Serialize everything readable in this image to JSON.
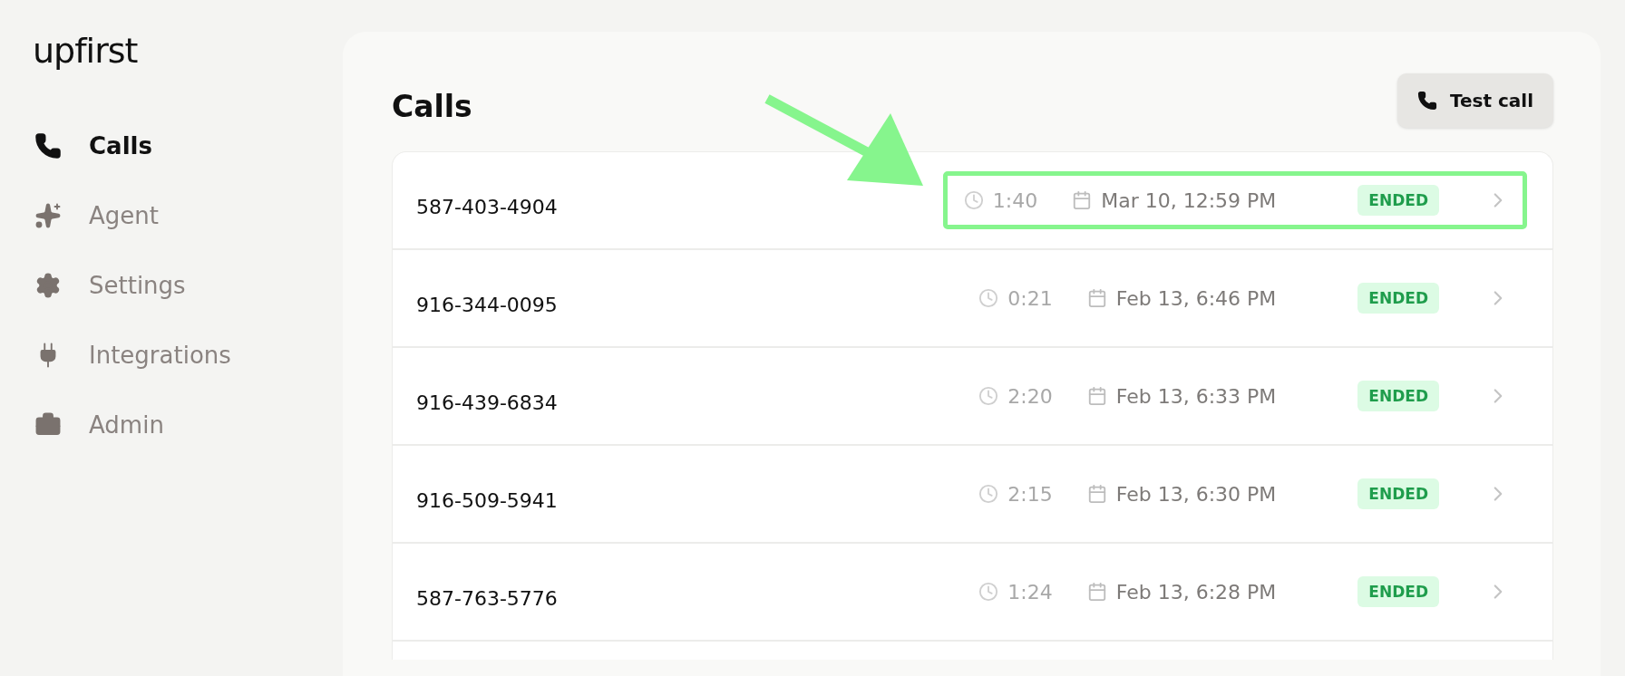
{
  "brand": {
    "name": "upfirst"
  },
  "sidebar": {
    "items": [
      {
        "label": "Calls",
        "selected": true
      },
      {
        "label": "Agent",
        "selected": false
      },
      {
        "label": "Settings",
        "selected": false
      },
      {
        "label": "Integrations",
        "selected": false
      },
      {
        "label": "Admin",
        "selected": false
      }
    ]
  },
  "page": {
    "title": "Calls",
    "test_button": "Test call"
  },
  "calls": [
    {
      "number": "587-403-4904",
      "duration": "1:40",
      "date": "Mar 10, 12:59 PM",
      "status": "ENDED",
      "highlighted": true
    },
    {
      "number": "916-344-0095",
      "duration": "0:21",
      "date": "Feb 13, 6:46 PM",
      "status": "ENDED",
      "highlighted": false
    },
    {
      "number": "916-439-6834",
      "duration": "2:20",
      "date": "Feb 13, 6:33 PM",
      "status": "ENDED",
      "highlighted": false
    },
    {
      "number": "916-509-5941",
      "duration": "2:15",
      "date": "Feb 13, 6:30 PM",
      "status": "ENDED",
      "highlighted": false
    },
    {
      "number": "587-763-5776",
      "duration": "1:24",
      "date": "Feb 13, 6:28 PM",
      "status": "ENDED",
      "highlighted": false
    }
  ]
}
